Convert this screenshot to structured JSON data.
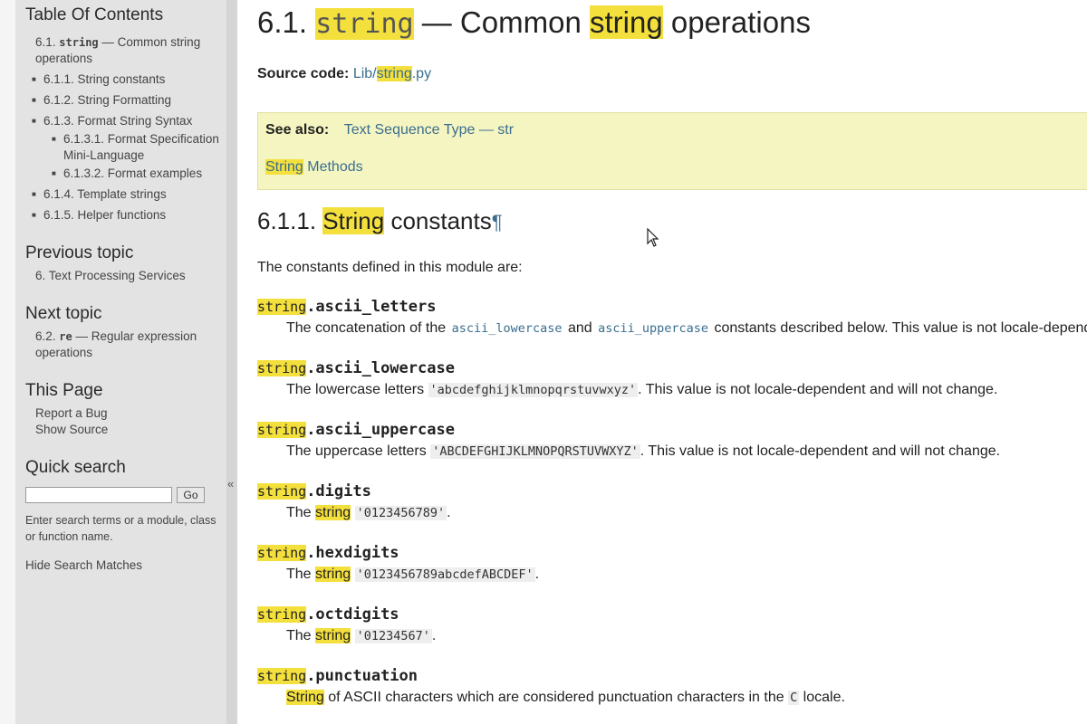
{
  "sidebar": {
    "toc_heading": "Table Of Contents",
    "toc_root_num": "6.1.",
    "toc_root_code": "string",
    "toc_root_rest": "— Common string operations",
    "toc_items": [
      {
        "label": "6.1.1. String constants"
      },
      {
        "label": "6.1.2. String Formatting"
      },
      {
        "label": "6.1.3. Format String Syntax"
      },
      {
        "label": "6.1.4. Template strings"
      },
      {
        "label": "6.1.5. Helper functions"
      }
    ],
    "toc_subitems": [
      {
        "label": "6.1.3.1. Format Specification Mini-Language"
      },
      {
        "label": "6.1.3.2. Format examples"
      }
    ],
    "prev_heading": "Previous topic",
    "prev_link": "6. Text Processing Services",
    "next_heading": "Next topic",
    "next_num": "6.2.",
    "next_code": "re",
    "next_rest": "— Regular expression operations",
    "this_page_heading": "This Page",
    "report_bug": "Report a Bug",
    "show_source": "Show Source",
    "search_heading": "Quick search",
    "search_value": "",
    "go_label": "Go",
    "search_help": "Enter search terms or a module, class or function name.",
    "hide_matches": "Hide Search Matches",
    "collapse_glyph": "«"
  },
  "main": {
    "title_num": "6.1.",
    "title_code": "string",
    "title_dash": "— Common",
    "title_word": "string",
    "title_rest": "operations",
    "source_label": "Source code:",
    "source_link_a": "Lib/",
    "source_link_b": "string",
    "source_link_c": ".py",
    "seealso_label": "See also:",
    "seealso_link1": "Text Sequence Type — str",
    "seealso_link2_a": "String",
    "seealso_link2_b": " Methods",
    "section_num": "6.1.1.",
    "section_word": "String",
    "section_rest": " constants",
    "pilcrow": "¶",
    "intro": "The constants defined in this module are:",
    "module_prefix": "string",
    "entries": [
      {
        "name": ".ascii_letters",
        "d1": "The concatenation of the ",
        "c1": "ascii_lowercase",
        "d2": " and ",
        "c2": "ascii_uppercase",
        "d3": " constants described below. This value is not locale-dependent."
      },
      {
        "name": ".ascii_lowercase",
        "d1": "The lowercase letters ",
        "c1": "'abcdefghijklmnopqrstuvwxyz'",
        "d2": ". This value is not locale-dependent and will not change."
      },
      {
        "name": ".ascii_uppercase",
        "d1": "The uppercase letters ",
        "c1": "'ABCDEFGHIJKLMNOPQRSTUVWXYZ'",
        "d2": ". This value is not locale-dependent and will not change."
      },
      {
        "name": ".digits",
        "d1": "The ",
        "hw": "string",
        "c1": "'0123456789'",
        "d2": "."
      },
      {
        "name": ".hexdigits",
        "d1": "The ",
        "hw": "string",
        "c1": "'0123456789abcdefABCDEF'",
        "d2": "."
      },
      {
        "name": ".octdigits",
        "d1": "The ",
        "hw": "string",
        "c1": "'01234567'",
        "d2": "."
      },
      {
        "name": ".punctuation",
        "hw": "String",
        "d1": " of ASCII characters which are considered punctuation characters in the ",
        "c1": "C",
        "d2": " locale."
      }
    ]
  }
}
